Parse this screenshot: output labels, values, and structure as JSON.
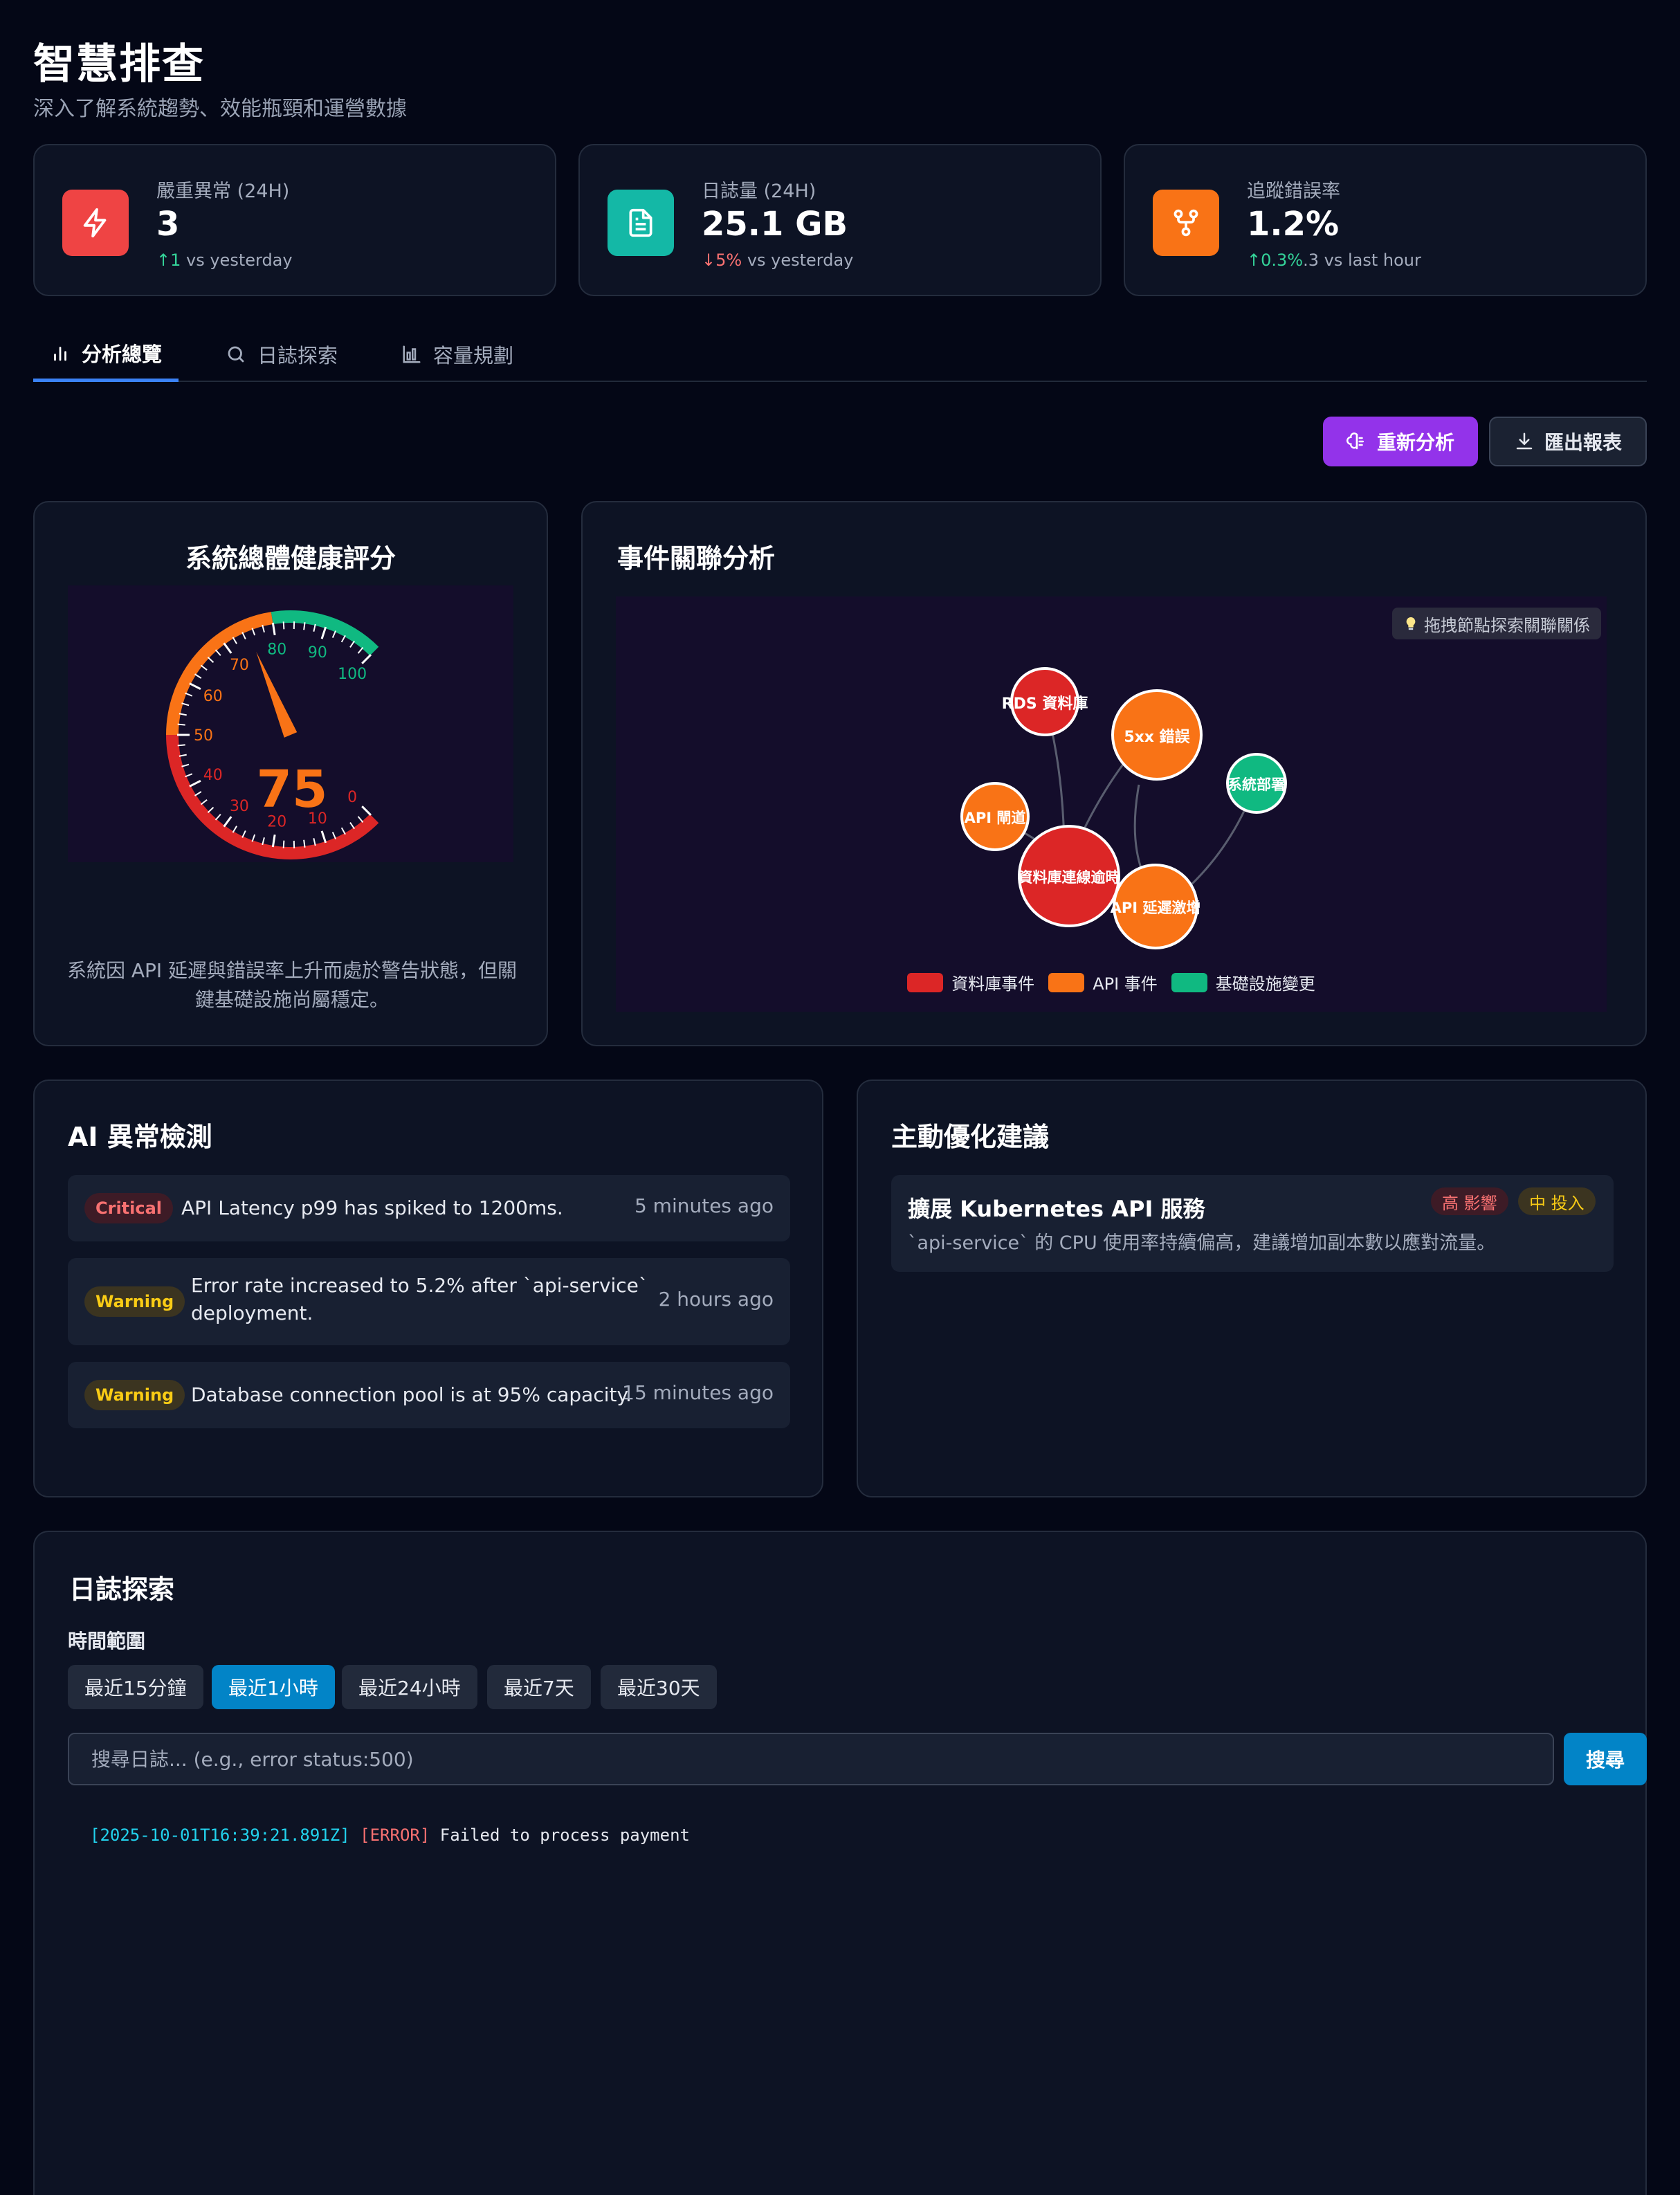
{
  "page": {
    "title": "智慧排查",
    "subtitle": "深入了解系統趨勢、效能瓶頸和運營數據"
  },
  "stats": [
    {
      "label": "嚴重異常 (24H)",
      "value": "3",
      "delta_arrow": "↑",
      "delta_value": "1",
      "delta_suffix": " vs yesterday",
      "icon": "lightning-icon",
      "color": "#ef4444"
    },
    {
      "label": "日誌量 (24H)",
      "value": "25.1 GB",
      "delta_arrow": "↓",
      "delta_value": "5%",
      "delta_suffix": " vs yesterday",
      "icon": "document-icon",
      "color": "#14b8a6"
    },
    {
      "label": "追蹤錯誤率",
      "value": "1.2%",
      "delta_arrow": "↑",
      "delta_value": "0.3%",
      "delta_suffix": ".3 vs last hour",
      "icon": "network-icon",
      "color": "#f97316"
    }
  ],
  "tabs": [
    {
      "label": "分析總覽",
      "icon": "bar-chart-icon",
      "active": true
    },
    {
      "label": "日誌探索",
      "icon": "search-icon",
      "active": false
    },
    {
      "label": "容量規劃",
      "icon": "column-chart-icon",
      "active": false
    }
  ],
  "actions": {
    "reanalyze_label": "重新分析",
    "export_label": "匯出報表"
  },
  "health": {
    "title": "系統總體健康評分",
    "score": 75,
    "score_text": "75",
    "gauge_min": 0,
    "gauge_max": 100,
    "ticks": [
      "0",
      "10",
      "20",
      "30",
      "40",
      "50",
      "60",
      "70",
      "80",
      "90",
      "100"
    ],
    "description": "系統因 API 延遲與錯誤率上升而處於警告狀態，但關鍵基礎設施尚屬穩定。",
    "colors": {
      "critical": "#dc2626",
      "warning": "#f97316",
      "good": "#10b981"
    }
  },
  "correlation": {
    "title": "事件關聯分析",
    "hint": "拖拽節點探索關聯關係",
    "nodes": [
      {
        "label": "RDS 資料庫",
        "group": "db"
      },
      {
        "label": "5xx 錯誤",
        "group": "api"
      },
      {
        "label": "系統部署",
        "group": "infra"
      },
      {
        "label": "API 閘道",
        "group": "api"
      },
      {
        "label": "資料庫連線逾時",
        "group": "db"
      },
      {
        "label": "API 延遲激增",
        "group": "api"
      }
    ],
    "legend": [
      {
        "label": "資料庫事件",
        "color": "#dc2626"
      },
      {
        "label": "API 事件",
        "color": "#f97316"
      },
      {
        "label": "基礎設施變更",
        "color": "#10b981"
      }
    ]
  },
  "anomalies": {
    "title": "AI 異常檢測",
    "items": [
      {
        "severity": "Critical",
        "message": "API Latency p99 has spiked to 1200ms.",
        "time": "5 minutes ago"
      },
      {
        "severity": "Warning",
        "message": "Error rate increased to 5.2% after `api-service`",
        "message2": "deployment.",
        "time": "2 hours ago"
      },
      {
        "severity": "Warning",
        "message": "Database connection pool is at 95% capacity.",
        "time": "15 minutes ago"
      }
    ]
  },
  "suggestions": {
    "title": "主動優化建議",
    "items": [
      {
        "title": "擴展 Kubernetes API 服務",
        "description": "`api-service` 的 CPU 使用率持續偏高，建議增加副本數以應對流量。",
        "impact": "高 影響",
        "effort": "中 投入"
      }
    ]
  },
  "logs": {
    "title": "日誌探索",
    "range_label": "時間範圍",
    "ranges": [
      "最近15分鐘",
      "最近1小時",
      "最近24小時",
      "最近7天",
      "最近30天"
    ],
    "active_range": 1,
    "search_placeholder": "搜尋日誌... (e.g., error status:500)",
    "search_value": "",
    "search_button": "搜尋",
    "entries": [
      {
        "timestamp": "[2025-10-01T16:39:21.891Z]",
        "level": "[ERROR]",
        "message": "Failed to process payment"
      }
    ]
  }
}
